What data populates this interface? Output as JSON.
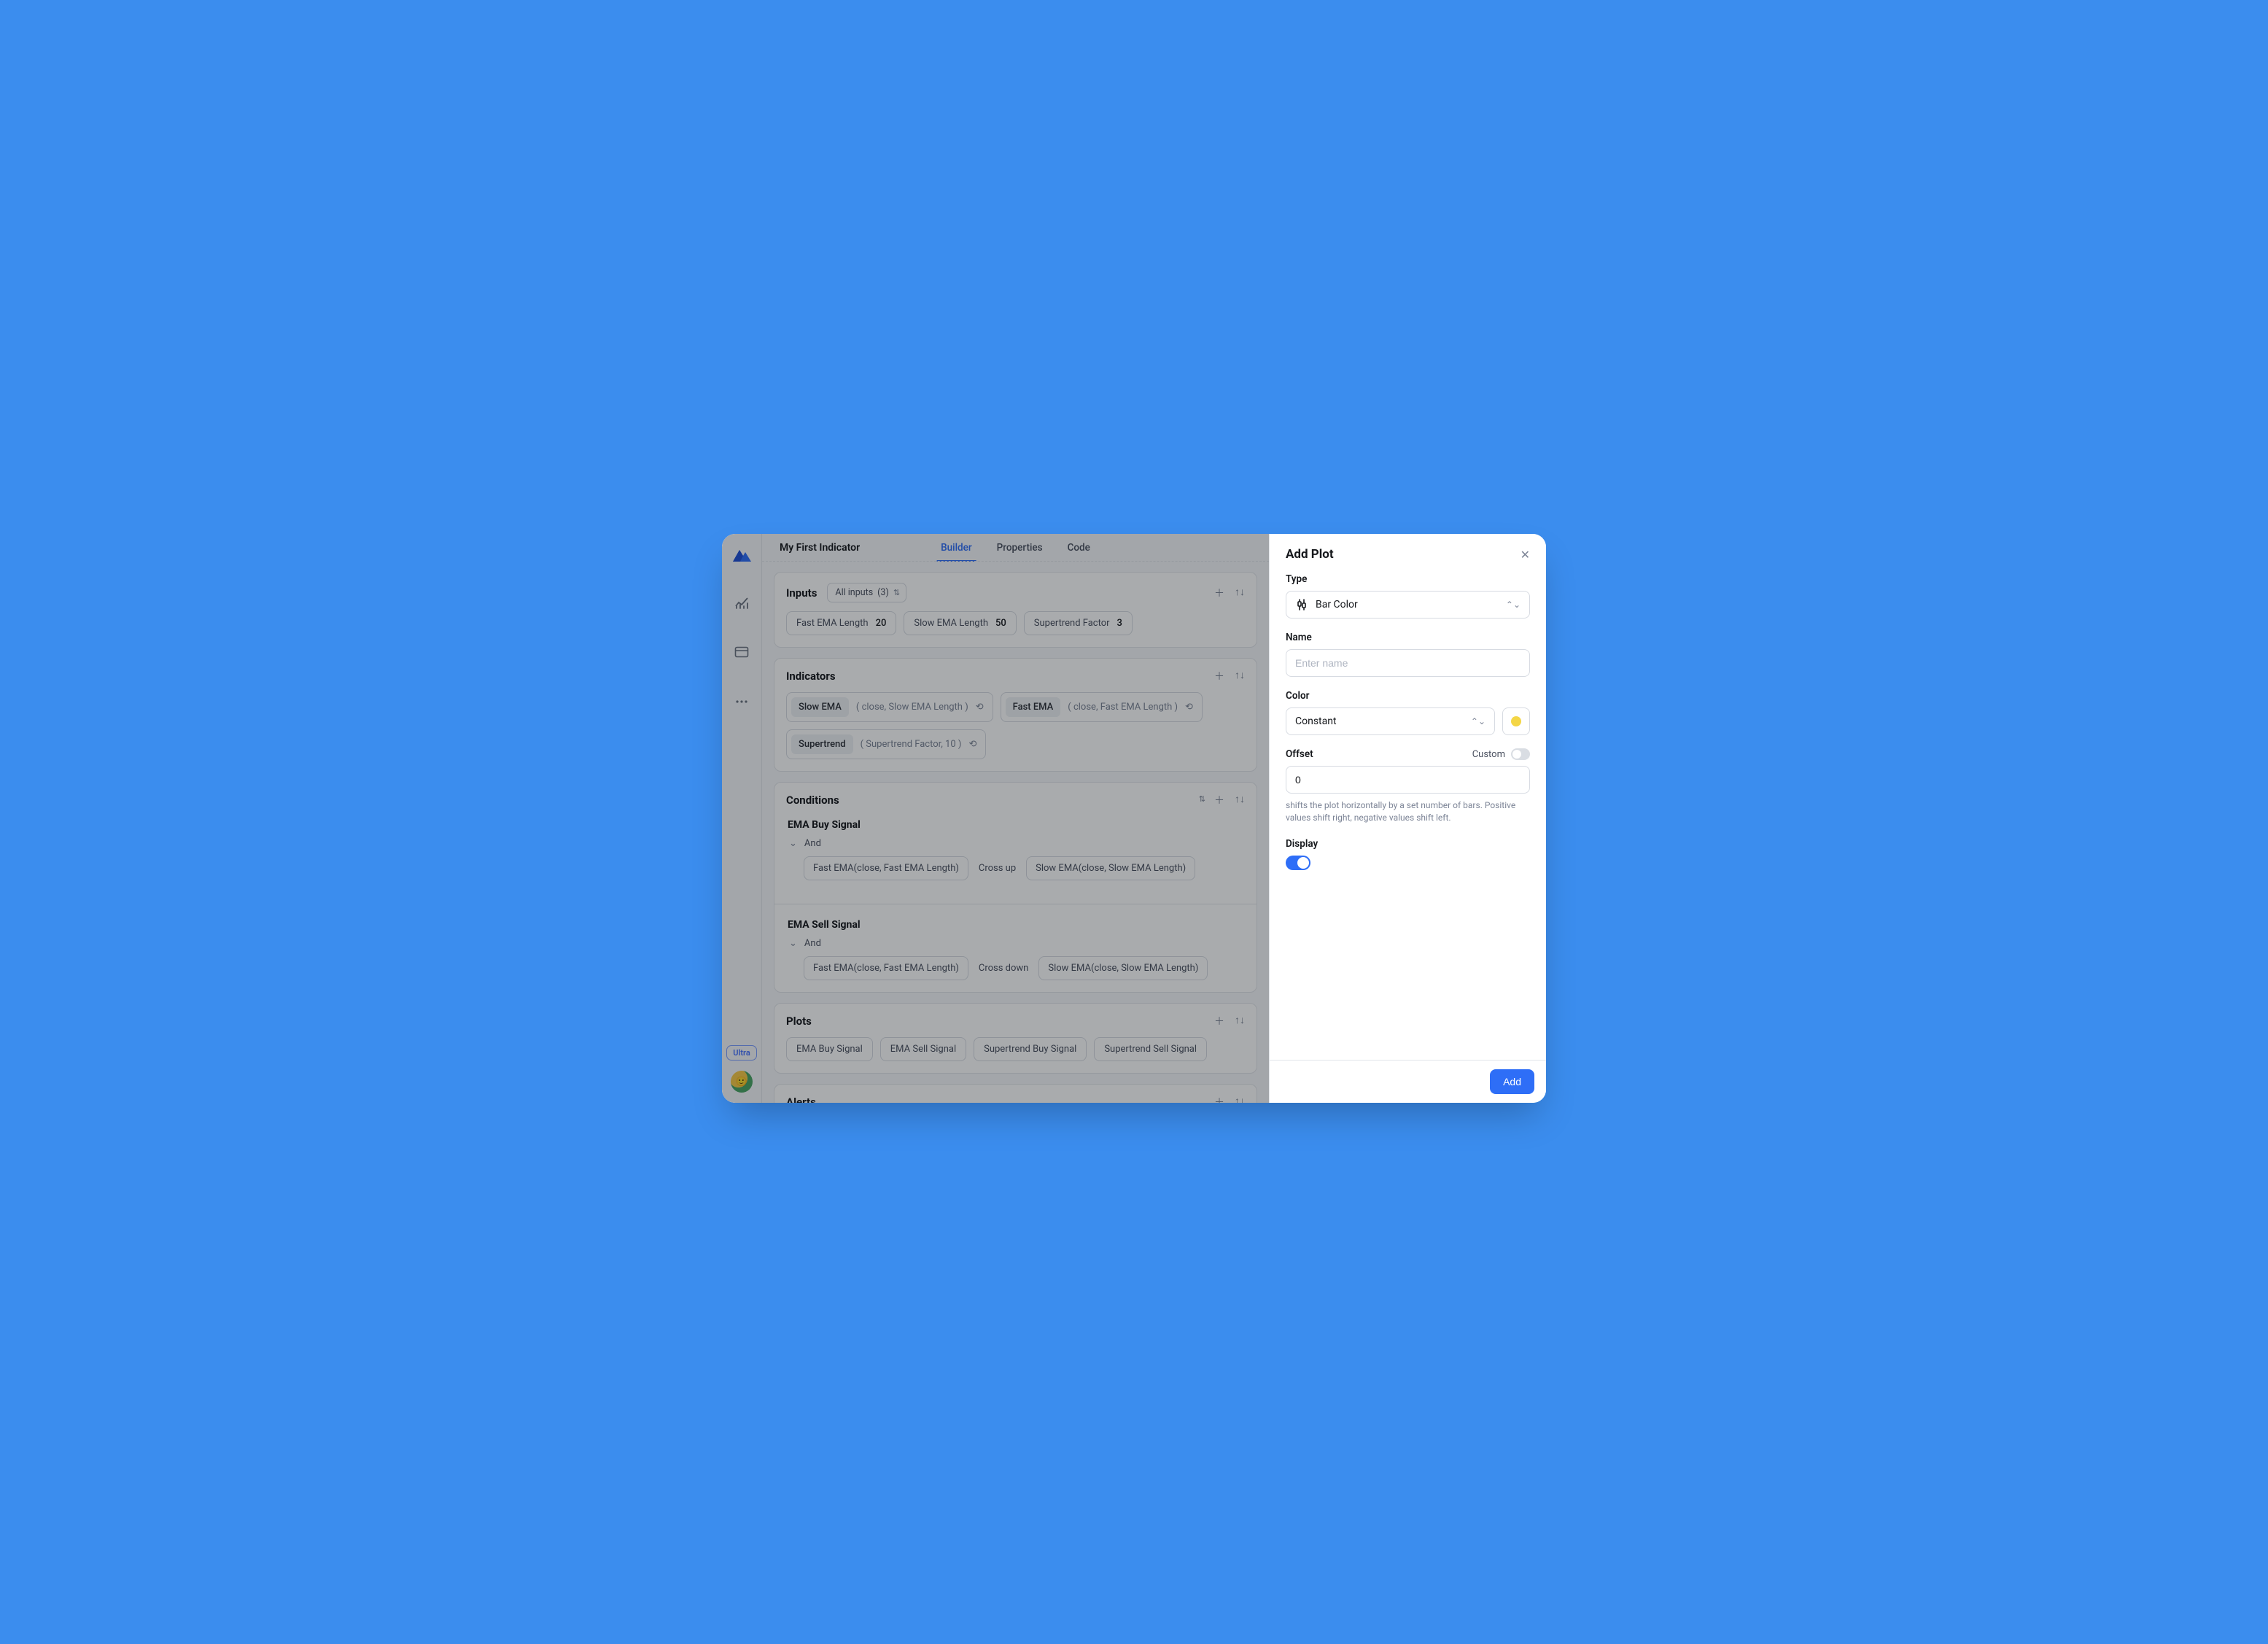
{
  "header": {
    "title": "My First Indicator",
    "tabs": {
      "builder": "Builder",
      "properties": "Properties",
      "code": "Code"
    }
  },
  "rail": {
    "badge": "Ultra"
  },
  "sections": {
    "inputs": {
      "title": "Inputs",
      "filter_prefix": "All inputs",
      "filter_count": "(3)",
      "items": [
        {
          "label": "Fast EMA Length",
          "value": "20"
        },
        {
          "label": "Slow EMA Length",
          "value": "50"
        },
        {
          "label": "Supertrend Factor",
          "value": "3"
        }
      ]
    },
    "indicators": {
      "title": "Indicators",
      "items": [
        {
          "name": "Slow EMA",
          "args": "( close, Slow EMA Length )"
        },
        {
          "name": "Fast EMA",
          "args": "( close, Fast EMA Length )"
        },
        {
          "name": "Supertrend",
          "args": "( Supertrend Factor, 10 )"
        }
      ]
    },
    "conditions": {
      "title": "Conditions",
      "groups": [
        {
          "name": "EMA Buy Signal",
          "op": "And",
          "left": "Fast EMA(close, Fast EMA Length)",
          "middle": "Cross up",
          "right": "Slow EMA(close, Slow EMA Length)"
        },
        {
          "name": "EMA Sell Signal",
          "op": "And",
          "left": "Fast EMA(close, Fast EMA Length)",
          "middle": "Cross down",
          "right": "Slow EMA(close, Slow EMA Length)"
        }
      ]
    },
    "plots": {
      "title": "Plots",
      "items": [
        "EMA Buy Signal",
        "EMA Sell Signal",
        "Supertrend Buy Signal",
        "Supertrend Sell Signal"
      ]
    },
    "alerts": {
      "title": "Alerts"
    }
  },
  "panel": {
    "title": "Add Plot",
    "type_label": "Type",
    "type_value": "Bar Color",
    "name_label": "Name",
    "name_placeholder": "Enter name",
    "color_label": "Color",
    "color_value": "Constant",
    "color_swatch": "#f4d646",
    "offset_label": "Offset",
    "offset_custom_label": "Custom",
    "offset_value": "0",
    "offset_help": "shifts the plot horizontally by a set number of bars. Positive values shift right, negative values shift left.",
    "display_label": "Display",
    "submit": "Add"
  }
}
